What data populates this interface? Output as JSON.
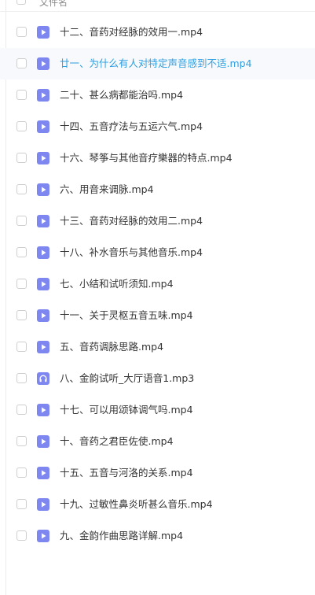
{
  "header": {
    "column_name": "文件名"
  },
  "colors": {
    "icon_bg": "#7e86f0",
    "link_hover": "#2f9fe0",
    "text": "#333333"
  },
  "files": [
    {
      "name": "十二、音药对经脉的效用一.mp4",
      "type": "video-icon"
    },
    {
      "name": "廿一、为什么有人对特定声音感到不适.mp4",
      "type": "video-icon",
      "hover": true
    },
    {
      "name": "二十、甚么病都能治吗.mp4",
      "type": "video-icon"
    },
    {
      "name": "十四、五音疗法与五运六气.mp4",
      "type": "video-icon"
    },
    {
      "name": "十六、琴筝与其他音疗樂器的特点.mp4",
      "type": "video-icon"
    },
    {
      "name": "六、用音来调脉.mp4",
      "type": "video-icon"
    },
    {
      "name": "十三、音药对经脉的效用二.mp4",
      "type": "video-icon"
    },
    {
      "name": "十八、补水音乐与其他音乐.mp4",
      "type": "video-icon"
    },
    {
      "name": "七、小结和试听须知.mp4",
      "type": "video-icon"
    },
    {
      "name": "十一、关于灵枢五音五味.mp4",
      "type": "video-icon"
    },
    {
      "name": "五、音药调脉思路.mp4",
      "type": "video-icon"
    },
    {
      "name": "八、金韵试听_大厅语音1.mp3",
      "type": "audio-icon"
    },
    {
      "name": "十七、可以用颂钵调气吗.mp4",
      "type": "video-icon"
    },
    {
      "name": "十、音药之君臣佐使.mp4",
      "type": "video-icon"
    },
    {
      "name": "十五、五音与河洛的关系.mp4",
      "type": "video-icon"
    },
    {
      "name": "十九、过敏性鼻炎听甚么音乐.mp4",
      "type": "video-icon"
    },
    {
      "name": "九、金韵作曲思路详解.mp4",
      "type": "video-icon"
    }
  ]
}
